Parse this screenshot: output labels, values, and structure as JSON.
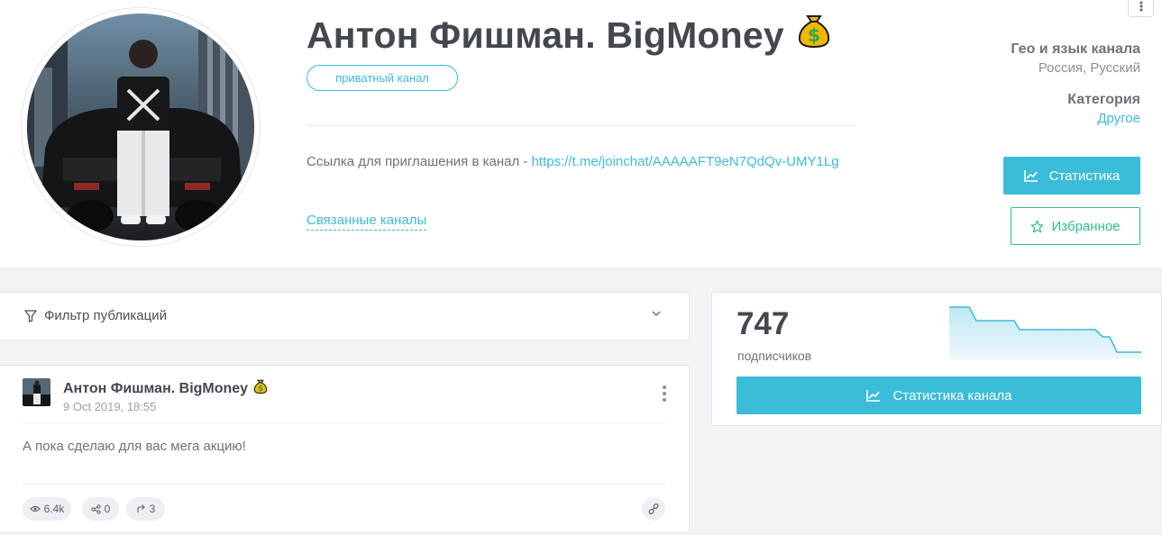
{
  "channel": {
    "title": "Антон Фишман. BigMoney",
    "title_emoji": "money-bag-icon",
    "badge": "приватный канал",
    "invite_prefix": "Ссылка для приглашения в канал - ",
    "invite_url": "https://t.me/joinchat/AAAAAFT9eN7QdQv-UMY1Lg",
    "related_label": "Связанные каналы"
  },
  "meta": {
    "geo_label": "Гео и язык канала",
    "geo_value": "Россия, Русский",
    "category_label": "Категория",
    "category_value": "Другое"
  },
  "buttons": {
    "stats": "Статистика",
    "favorites": "Избранное",
    "channel_stats": "Статистика канала"
  },
  "filter": {
    "label": "Фильтр публикаций"
  },
  "post": {
    "author": "Антон Фишман. BigMoney",
    "date": "9 Oct 2019, 18:55",
    "text": "А пока сделаю для вас мега акцию!",
    "views": "6.4k",
    "shares": "0",
    "forwards": "3"
  },
  "subscribers": {
    "count": "747",
    "label": "подписчиков"
  },
  "colors": {
    "accent": "#3bbcd8",
    "favorite": "#2ebd98",
    "text_dark": "#43474f",
    "page_bg": "#f2f3f7"
  }
}
